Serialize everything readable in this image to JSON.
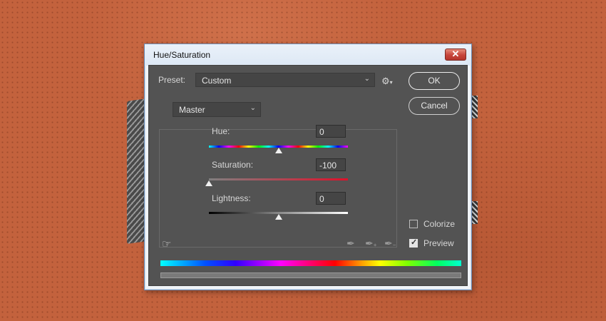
{
  "window": {
    "title": "Hue/Saturation",
    "close_label": "✕"
  },
  "preset": {
    "label": "Preset:",
    "value": "Custom"
  },
  "buttons": {
    "ok": "OK",
    "cancel": "Cancel"
  },
  "channel": {
    "value": "Master"
  },
  "sliders": {
    "hue": {
      "label": "Hue:",
      "value": "0",
      "fraction": 0.5
    },
    "saturation": {
      "label": "Saturation:",
      "value": "-100",
      "fraction": 0.0
    },
    "lightness": {
      "label": "Lightness:",
      "value": "0",
      "fraction": 0.5
    }
  },
  "options": {
    "colorize": {
      "label": "Colorize",
      "checked": false
    },
    "preview": {
      "label": "Preview",
      "checked": true
    }
  },
  "icons": {
    "settings": "gear-icon",
    "target_adjust": "hand-target-icon",
    "eyedropper": "eyedropper-icon",
    "eyedropper_add": "eyedropper-plus-icon",
    "eyedropper_subtract": "eyedropper-minus-icon"
  }
}
